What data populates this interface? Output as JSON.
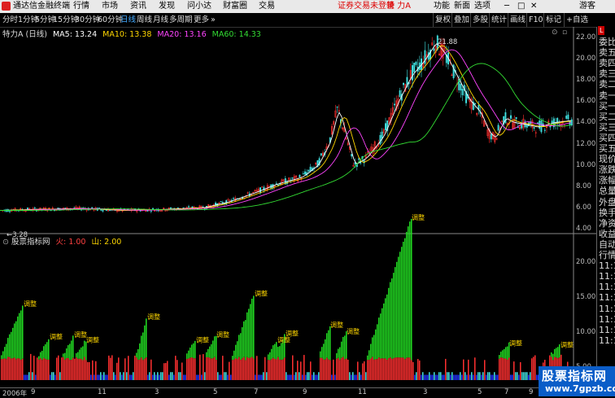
{
  "menubar": {
    "app_title": "通达信金融终端",
    "items": [
      "行情",
      "市场",
      "资讯",
      "发现",
      "问小达",
      "财富圈",
      "交易"
    ],
    "trade_status": "证券交易未登录",
    "stock_name": "特 力A",
    "right_items": [
      "功能",
      "新面",
      "选项"
    ],
    "guest": "游客"
  },
  "toolbar": {
    "periods": [
      "分时",
      "1分钟",
      "5分钟",
      "15分钟",
      "30分钟",
      "60分钟",
      "日线",
      "周线",
      "月线",
      "多周期",
      "更多"
    ],
    "selected_period": "日线",
    "right_buttons": [
      "复权",
      "叠加",
      "多股",
      "统计",
      "画线",
      "F10",
      "标记",
      "+自选"
    ]
  },
  "main_chart": {
    "stock_label": "特力A (日线)",
    "ma_labels": [
      {
        "text": "MA5: 13.24",
        "color": "#ffffff"
      },
      {
        "text": "MA10: 13.38",
        "color": "#ffd700"
      },
      {
        "text": "MA20: 13.16",
        "color": "#ff44ff"
      },
      {
        "text": "MA60: 14.33",
        "color": "#33dd33"
      }
    ],
    "y_ticks": [
      "22.00",
      "20.00",
      "18.00",
      "16.00",
      "14.00",
      "12.00",
      "10.00",
      "8.00",
      "6.00",
      "4.00"
    ],
    "high_label": "21.88",
    "low_label": "3.28"
  },
  "indicator": {
    "name": "股票指标网",
    "fire_label": "火: 1.00",
    "mountain_label": "山: 2.00",
    "y_ticks": [
      "20.00",
      "15.00",
      "10.00",
      "5.00"
    ],
    "annotation_label": "调整",
    "top_label": "调整"
  },
  "right_panel": {
    "header": "L",
    "items": [
      "委比",
      "卖五",
      "卖四",
      "卖三",
      "卖二",
      "卖一",
      "买一",
      "买二",
      "买三",
      "买四",
      "买五",
      "现价",
      "涨跌",
      "涨幅",
      "总量",
      "外盘",
      "换手",
      "净资",
      "收益",
      "自动",
      "行情",
      "11:1",
      "11:1",
      "11:1",
      "11:1",
      "11:1",
      "11:1",
      "11:1",
      "11:1"
    ]
  },
  "x_axis": {
    "labels": [
      "2006年",
      "9",
      "11",
      "3",
      "5",
      "7",
      "9",
      "11",
      "3",
      "5",
      "7",
      "9",
      "11"
    ]
  },
  "watermark": {
    "line1": "股票指标网",
    "line2": "www.7gpzb.com"
  },
  "colors": {
    "up": "#ff3030",
    "down": "#40e0e0",
    "green_bar": "#22dd22",
    "blue_bar": "#2233ff",
    "ma5": "#ffffff",
    "ma10": "#ffd700",
    "ma20": "#ff44ff",
    "ma60": "#33dd33"
  }
}
